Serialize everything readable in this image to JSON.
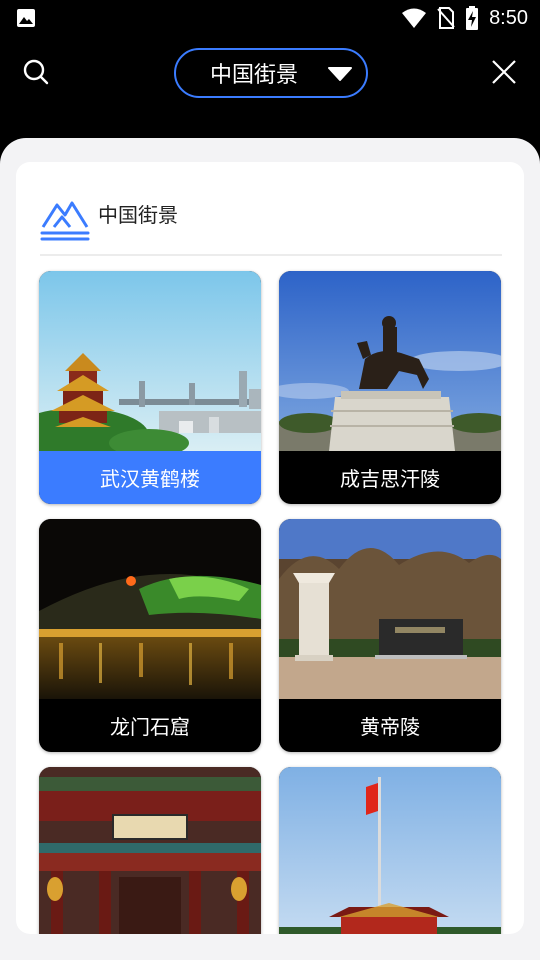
{
  "status_bar": {
    "time": "8:50",
    "icons": [
      "image-icon",
      "wifi-icon",
      "no-sim-icon",
      "battery-charging-icon"
    ]
  },
  "header": {
    "search_icon": "search-icon",
    "selector_label": "中国街景",
    "selector_icon": "caret-down-icon",
    "close_icon": "close-icon",
    "accent_color": "#3b7cff"
  },
  "section": {
    "title": "中国街景",
    "icon": "mountain-logo-icon"
  },
  "tiles": [
    {
      "label": "武汉黄鹤楼",
      "selected": true
    },
    {
      "label": "成吉思汗陵",
      "selected": false
    },
    {
      "label": "龙门石窟",
      "selected": false
    },
    {
      "label": "黄帝陵",
      "selected": false
    },
    {
      "label": "",
      "selected": false
    },
    {
      "label": "",
      "selected": false
    }
  ]
}
